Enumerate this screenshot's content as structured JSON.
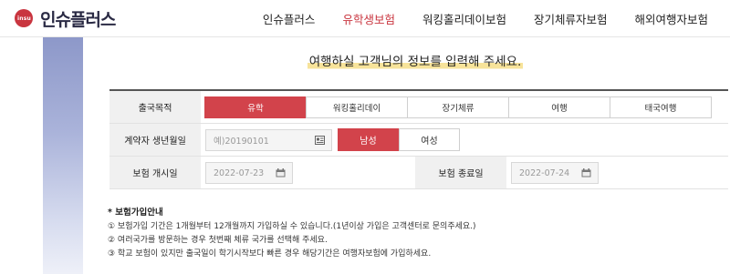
{
  "brand": {
    "name": "인슈플러스",
    "mark_text": "insu",
    "color": "#c9353f"
  },
  "nav": {
    "items": [
      {
        "label": "인슈플러스",
        "active": false
      },
      {
        "label": "유학생보험",
        "active": true
      },
      {
        "label": "워킹홀리데이보험",
        "active": false
      },
      {
        "label": "장기체류자보험",
        "active": false
      },
      {
        "label": "해외여행자보험",
        "active": false
      }
    ]
  },
  "heading": "여행하실 고객님의 정보를 입력해 주세요.",
  "form": {
    "purpose": {
      "label": "출국목적",
      "options": [
        "유학",
        "워킹홀리데이",
        "장기체류",
        "여행",
        "태국여행"
      ],
      "selected": "유학"
    },
    "birth": {
      "label": "계약자 생년월일",
      "placeholder": "예)20190101",
      "icon": "id-card-icon"
    },
    "gender": {
      "options": [
        "남성",
        "여성"
      ],
      "selected": "남성"
    },
    "start_date": {
      "label": "보험 개시일",
      "value": "2022-07-23",
      "icon": "calendar-icon"
    },
    "end_date": {
      "label": "보험 종료일",
      "value": "2022-07-24",
      "icon": "calendar-icon"
    }
  },
  "notes": {
    "title": "* 보험가입안내",
    "items": [
      "① 보험가입 기간은 1개월부터 12개월까지 가입하실 수 있습니다.(1년이상 가입은 고객센터로 문의주세요.)",
      "② 여러국가를 방문하는 경우 첫번째 체류 국가를 선택해 주세요.",
      "③ 학교 보험이 있지만 출국일이 학기시작보다 빠른 경우 해당기간은 여행자보험에 가입하세요."
    ]
  },
  "colors": {
    "accent": "#d2434b",
    "highlight": "#f7e39a",
    "side_gradient_top": "#8d98c9"
  }
}
